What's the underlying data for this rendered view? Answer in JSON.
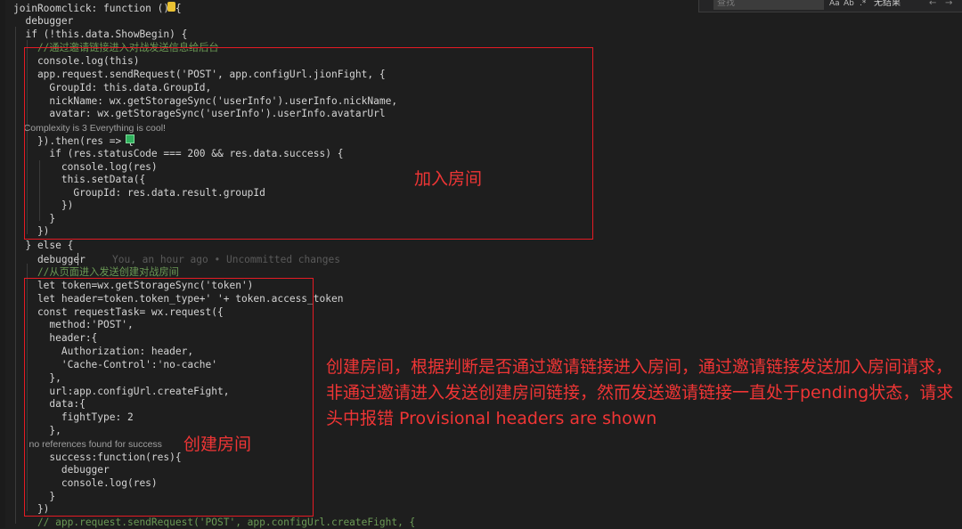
{
  "editor": {
    "lines": [
      {
        "text": "joinRoomclick: function () {",
        "kind": "code"
      },
      {
        "text": "  debugger",
        "kind": "code"
      },
      {
        "text": "  if (!this.data.ShowBegin) {",
        "kind": "code"
      },
      {
        "text": "    //通过邀请链接进入对战发送信息给后台",
        "kind": "comment"
      },
      {
        "text": "    console.log(this)",
        "kind": "code"
      },
      {
        "text": "    app.request.sendRequest('POST', app.configUrl.jionFight, {",
        "kind": "code"
      },
      {
        "text": "      GroupId: this.data.GroupId,",
        "kind": "code"
      },
      {
        "text": "      nickName: wx.getStorageSync('userInfo').userInfo.nickName,",
        "kind": "code"
      },
      {
        "text": "      avatar: wx.getStorageSync('userInfo').userInfo.avatarUrl",
        "kind": "code"
      },
      {
        "text": "    Complexity is 3 Everything is cool!",
        "kind": "codelens"
      },
      {
        "text": "    }).then(res => {",
        "kind": "code"
      },
      {
        "text": "      if (res.statusCode === 200 && res.data.success) {",
        "kind": "code"
      },
      {
        "text": "        console.log(res)",
        "kind": "code"
      },
      {
        "text": "        this.setData({",
        "kind": "code"
      },
      {
        "text": "          GroupId: res.data.result.groupId",
        "kind": "code"
      },
      {
        "text": "        })",
        "kind": "code"
      },
      {
        "text": "      }",
        "kind": "code"
      },
      {
        "text": "    })",
        "kind": "code"
      },
      {
        "text": "  } else {",
        "kind": "code"
      },
      {
        "text": "    debugger",
        "kind": "code"
      },
      {
        "text": "    //从页面进入发送创建对战房间",
        "kind": "comment"
      },
      {
        "text": "    let token=wx.getStorageSync('token')",
        "kind": "code"
      },
      {
        "text": "    let header=token.token_type+' '+ token.access_token",
        "kind": "code"
      },
      {
        "text": "    const requestTask= wx.request({",
        "kind": "code"
      },
      {
        "text": "      method:'POST',",
        "kind": "code"
      },
      {
        "text": "      header:{",
        "kind": "code"
      },
      {
        "text": "        Authorization: header,",
        "kind": "code"
      },
      {
        "text": "        'Cache-Control':'no-cache'",
        "kind": "code"
      },
      {
        "text": "      },",
        "kind": "code"
      },
      {
        "text": "      url:app.configUrl.createFight,",
        "kind": "code"
      },
      {
        "text": "      data:{",
        "kind": "code"
      },
      {
        "text": "        fightType: 2",
        "kind": "code"
      },
      {
        "text": "      },",
        "kind": "code"
      },
      {
        "text": "      no references found for success",
        "kind": "codelens"
      },
      {
        "text": "      success:function(res){",
        "kind": "code"
      },
      {
        "text": "        debugger",
        "kind": "code"
      },
      {
        "text": "        console.log(res)",
        "kind": "code"
      },
      {
        "text": "      }",
        "kind": "code"
      },
      {
        "text": "    })",
        "kind": "code"
      },
      {
        "text": "    // app.request.sendRequest('POST', app.configUrl.createFight, {",
        "kind": "comment"
      }
    ],
    "blame": "You, an hour ago • Uncommitted changes"
  },
  "find_widget": {
    "placeholder": "查找",
    "match_case": "Aa",
    "whole_word": "Ab",
    "regex": ".*",
    "result": "无结果",
    "prev": "←",
    "next": "→"
  },
  "annotations": {
    "join_room_label": "加入房间",
    "create_room_label": "创建房间",
    "note": "创建房间，根据判断是否通过邀请链接进入房间，通过邀请链接发送加入房间请求，非通过邀请进入发送创建房间链接，然而发送邀请链接一直处于pending状态，请求头中报错 Provisional headers are shown"
  },
  "colors": {
    "background": "#1e1e1e",
    "code_text": "#d4d4d4",
    "comment": "#6a9955",
    "annotation_red": "#e51b24"
  }
}
